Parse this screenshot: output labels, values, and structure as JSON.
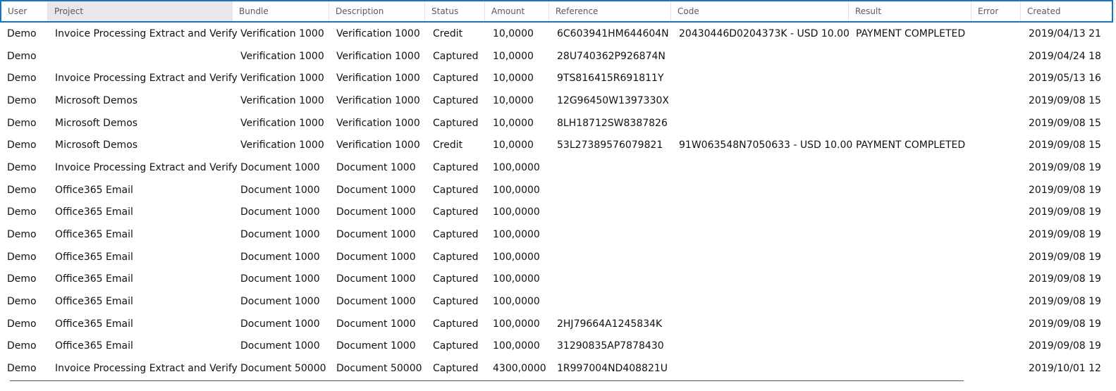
{
  "columns": [
    "User",
    "Project",
    "Bundle",
    "Description",
    "Status",
    "Amount",
    "Reference",
    "Code",
    "Result",
    "Error",
    "Created"
  ],
  "rows": [
    [
      "Demo",
      "Invoice Processing Extract and Verify",
      "Verification 1000",
      "Verification 1000",
      "Credit",
      "10,0000",
      "6C603941HM644604N",
      "20430446D0204373K - USD 10.00",
      "PAYMENT COMPLETED",
      "",
      "2019/04/13 21"
    ],
    [
      "Demo",
      "",
      "Verification 1000",
      "Verification 1000",
      "Captured",
      "10,0000",
      "28U740362P926874N",
      "",
      "",
      "",
      "2019/04/24 18"
    ],
    [
      "Demo",
      "Invoice Processing Extract and Verify",
      "Verification 1000",
      "Verification 1000",
      "Captured",
      "10,0000",
      "9TS816415R691811Y",
      "",
      "",
      "",
      "2019/05/13 16"
    ],
    [
      "Demo",
      "Microsoft Demos",
      "Verification 1000",
      "Verification 1000",
      "Captured",
      "10,0000",
      "12G96450W1397330X",
      "",
      "",
      "",
      "2019/09/08 15"
    ],
    [
      "Demo",
      "Microsoft Demos",
      "Verification 1000",
      "Verification 1000",
      "Captured",
      "10,0000",
      "8LH18712SW8387826",
      "",
      "",
      "",
      "2019/09/08 15"
    ],
    [
      "Demo",
      "Microsoft Demos",
      "Verification 1000",
      "Verification 1000",
      "Credit",
      "10,0000",
      "53L27389576079821",
      "91W063548N7050633 - USD 10.00",
      "PAYMENT COMPLETED",
      "",
      "2019/09/08 15"
    ],
    [
      "Demo",
      "Invoice Processing Extract and Verify",
      "Document 1000",
      "Document 1000",
      "Captured",
      "100,0000",
      "",
      "",
      "",
      "",
      "2019/09/08 19"
    ],
    [
      "Demo",
      "Office365 Email",
      "Document 1000",
      "Document 1000",
      "Captured",
      "100,0000",
      "",
      "",
      "",
      "",
      "2019/09/08 19"
    ],
    [
      "Demo",
      "Office365 Email",
      "Document 1000",
      "Document 1000",
      "Captured",
      "100,0000",
      "",
      "",
      "",
      "",
      "2019/09/08 19"
    ],
    [
      "Demo",
      "Office365 Email",
      "Document 1000",
      "Document 1000",
      "Captured",
      "100,0000",
      "",
      "",
      "",
      "",
      "2019/09/08 19"
    ],
    [
      "Demo",
      "Office365 Email",
      "Document 1000",
      "Document 1000",
      "Captured",
      "100,0000",
      "",
      "",
      "",
      "",
      "2019/09/08 19"
    ],
    [
      "Demo",
      "Office365 Email",
      "Document 1000",
      "Document 1000",
      "Captured",
      "100,0000",
      "",
      "",
      "",
      "",
      "2019/09/08 19"
    ],
    [
      "Demo",
      "Office365 Email",
      "Document 1000",
      "Document 1000",
      "Captured",
      "100,0000",
      "",
      "",
      "",
      "",
      "2019/09/08 19"
    ],
    [
      "Demo",
      "Office365 Email",
      "Document 1000",
      "Document 1000",
      "Captured",
      "100,0000",
      "2HJ79664A1245834K",
      "",
      "",
      "",
      "2019/09/08 19"
    ],
    [
      "Demo",
      "Office365 Email",
      "Document 1000",
      "Document 1000",
      "Captured",
      "100,0000",
      "31290835AP7878430",
      "",
      "",
      "",
      "2019/09/08 19"
    ],
    [
      "Demo",
      "Invoice Processing Extract and Verify",
      "Document 50000",
      "Document 50000",
      "Captured",
      "4300,0000",
      "1R997004ND408821U",
      "",
      "",
      "",
      "2019/10/01 12"
    ]
  ]
}
